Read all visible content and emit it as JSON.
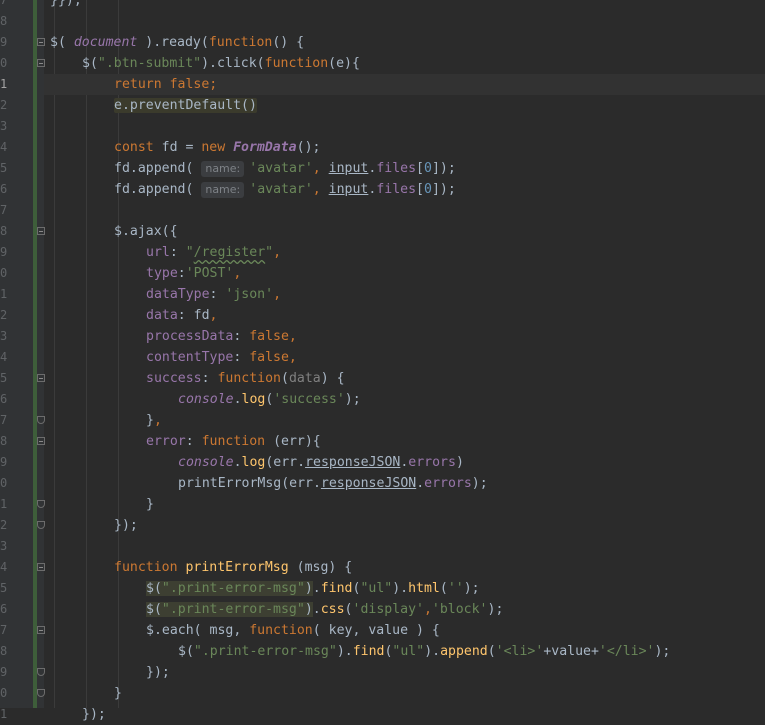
{
  "editor": {
    "current_line_index": 4,
    "lines": [
      {
        "num": "7",
        "fold": "",
        "indent": 0,
        "tokens": [
          [
            "p",
            "}});"
          ]
        ]
      },
      {
        "num": "8",
        "fold": "",
        "indent": 0,
        "tokens": []
      },
      {
        "num": "9",
        "fold": "open",
        "indent": 0,
        "tokens": [
          [
            "p",
            "$( "
          ],
          [
            "glob",
            "document"
          ],
          [
            "p",
            " ).ready("
          ],
          [
            "kw",
            "function"
          ],
          [
            "p",
            "() {"
          ]
        ]
      },
      {
        "num": "0",
        "fold": "open",
        "indent": 1,
        "tokens": [
          [
            "p",
            "$("
          ],
          [
            "str",
            "\".btn-submit\""
          ],
          [
            "p",
            ").click("
          ],
          [
            "kw",
            "function"
          ],
          [
            "p",
            "(e){"
          ]
        ]
      },
      {
        "num": "1",
        "fold": "",
        "indent": 2,
        "tokens": [
          [
            "kw",
            "return "
          ],
          [
            "kw",
            "false"
          ],
          [
            "kw",
            ";"
          ]
        ]
      },
      {
        "num": "2",
        "fold": "",
        "indent": 2,
        "tokens": [
          [
            "hl",
            "e.preventDefault()"
          ]
        ]
      },
      {
        "num": "3",
        "fold": "",
        "indent": 0,
        "tokens": []
      },
      {
        "num": "4",
        "fold": "",
        "indent": 2,
        "tokens": [
          [
            "kw",
            "const "
          ],
          [
            "p",
            "fd = "
          ],
          [
            "kw",
            "new "
          ],
          [
            "cls",
            "FormData"
          ],
          [
            "p",
            "();"
          ]
        ]
      },
      {
        "num": "5",
        "fold": "",
        "indent": 2,
        "tokens": [
          [
            "p",
            "fd.append( "
          ],
          [
            "hint",
            "name:"
          ],
          [
            "str",
            "'avatar'"
          ],
          [
            "kw",
            ", "
          ],
          [
            "ul",
            "input"
          ],
          [
            "p",
            "."
          ],
          [
            "prop",
            "files"
          ],
          [
            "p",
            "["
          ],
          [
            "num",
            "0"
          ],
          [
            "p",
            "]);"
          ]
        ]
      },
      {
        "num": "6",
        "fold": "",
        "indent": 2,
        "tokens": [
          [
            "p",
            "fd.append( "
          ],
          [
            "hint",
            "name:"
          ],
          [
            "str",
            "'avatar'"
          ],
          [
            "kw",
            ", "
          ],
          [
            "ul",
            "input"
          ],
          [
            "p",
            "."
          ],
          [
            "prop",
            "files"
          ],
          [
            "p",
            "["
          ],
          [
            "num",
            "0"
          ],
          [
            "p",
            "]);"
          ]
        ]
      },
      {
        "num": "7",
        "fold": "",
        "indent": 0,
        "tokens": []
      },
      {
        "num": "8",
        "fold": "open",
        "indent": 2,
        "tokens": [
          [
            "p",
            "$.ajax({"
          ]
        ]
      },
      {
        "num": "9",
        "fold": "",
        "indent": 3,
        "tokens": [
          [
            "prop",
            "url"
          ],
          [
            "p",
            ": "
          ],
          [
            "str",
            "\""
          ],
          [
            "wavy",
            "/register"
          ],
          [
            "str",
            "\""
          ],
          [
            "kw",
            ","
          ]
        ]
      },
      {
        "num": "0",
        "fold": "",
        "indent": 3,
        "tokens": [
          [
            "prop",
            "type"
          ],
          [
            "p",
            ":"
          ],
          [
            "str",
            "'POST'"
          ],
          [
            "kw",
            ","
          ]
        ]
      },
      {
        "num": "1",
        "fold": "",
        "indent": 3,
        "tokens": [
          [
            "prop",
            "dataType"
          ],
          [
            "p",
            ": "
          ],
          [
            "str",
            "'json'"
          ],
          [
            "kw",
            ","
          ]
        ]
      },
      {
        "num": "2",
        "fold": "",
        "indent": 3,
        "tokens": [
          [
            "prop",
            "data"
          ],
          [
            "p",
            ": fd"
          ],
          [
            "kw",
            ","
          ]
        ]
      },
      {
        "num": "3",
        "fold": "",
        "indent": 3,
        "tokens": [
          [
            "prop",
            "processData"
          ],
          [
            "p",
            ": "
          ],
          [
            "kw",
            "false,"
          ]
        ]
      },
      {
        "num": "4",
        "fold": "",
        "indent": 3,
        "tokens": [
          [
            "prop",
            "contentType"
          ],
          [
            "p",
            ": "
          ],
          [
            "kw",
            "false,"
          ]
        ]
      },
      {
        "num": "5",
        "fold": "open",
        "indent": 3,
        "tokens": [
          [
            "prop",
            "success"
          ],
          [
            "p",
            ": "
          ],
          [
            "kw",
            "function"
          ],
          [
            "p",
            "("
          ],
          [
            "dim",
            "data"
          ],
          [
            "p",
            ") {"
          ]
        ]
      },
      {
        "num": "6",
        "fold": "",
        "indent": 4,
        "tokens": [
          [
            "glob",
            "console"
          ],
          [
            "p",
            "."
          ],
          [
            "fn",
            "log"
          ],
          [
            "p",
            "("
          ],
          [
            "str",
            "'success'"
          ],
          [
            "p",
            ");"
          ]
        ]
      },
      {
        "num": "7",
        "fold": "end",
        "indent": 3,
        "tokens": [
          [
            "p",
            "}"
          ],
          [
            "kw",
            ","
          ]
        ]
      },
      {
        "num": "8",
        "fold": "open",
        "indent": 3,
        "tokens": [
          [
            "prop",
            "error"
          ],
          [
            "p",
            ": "
          ],
          [
            "kw",
            "function "
          ],
          [
            "p",
            "(err){"
          ]
        ]
      },
      {
        "num": "9",
        "fold": "",
        "indent": 4,
        "tokens": [
          [
            "glob",
            "console"
          ],
          [
            "p",
            "."
          ],
          [
            "fn",
            "log"
          ],
          [
            "p",
            "(err."
          ],
          [
            "ul",
            "responseJSON"
          ],
          [
            "p",
            "."
          ],
          [
            "prop",
            "errors"
          ],
          [
            "p",
            ")"
          ]
        ]
      },
      {
        "num": "0",
        "fold": "",
        "indent": 4,
        "tokens": [
          [
            "p",
            "printErrorMsg(err."
          ],
          [
            "ul",
            "responseJSON"
          ],
          [
            "p",
            "."
          ],
          [
            "prop",
            "errors"
          ],
          [
            "p",
            ");"
          ]
        ]
      },
      {
        "num": "1",
        "fold": "end",
        "indent": 3,
        "tokens": [
          [
            "p",
            "}"
          ]
        ]
      },
      {
        "num": "2",
        "fold": "end",
        "indent": 2,
        "tokens": [
          [
            "p",
            "});"
          ]
        ]
      },
      {
        "num": "3",
        "fold": "",
        "indent": 0,
        "tokens": []
      },
      {
        "num": "4",
        "fold": "open",
        "indent": 2,
        "tokens": [
          [
            "kw",
            "function "
          ],
          [
            "fn",
            "printErrorMsg "
          ],
          [
            "p",
            "(msg) {"
          ]
        ]
      },
      {
        "num": "5",
        "fold": "",
        "indent": 3,
        "tokens": [
          [
            "hl2",
            "$("
          ],
          [
            "hl2s",
            "\".print-error-msg\""
          ],
          [
            "hl2",
            ")"
          ],
          [
            "p",
            "."
          ],
          [
            "fn",
            "find"
          ],
          [
            "p",
            "("
          ],
          [
            "str",
            "\"ul\""
          ],
          [
            "p",
            ")."
          ],
          [
            "fn",
            "html"
          ],
          [
            "p",
            "("
          ],
          [
            "str",
            "''"
          ],
          [
            "p",
            ");"
          ]
        ]
      },
      {
        "num": "6",
        "fold": "",
        "indent": 3,
        "tokens": [
          [
            "hl2",
            "$("
          ],
          [
            "hl2s",
            "\".print-error-msg\""
          ],
          [
            "hl2",
            ")"
          ],
          [
            "p",
            "."
          ],
          [
            "fn",
            "css"
          ],
          [
            "p",
            "("
          ],
          [
            "str",
            "'display'"
          ],
          [
            "kw",
            ","
          ],
          [
            "str",
            "'block'"
          ],
          [
            "p",
            ");"
          ]
        ]
      },
      {
        "num": "7",
        "fold": "open",
        "indent": 3,
        "tokens": [
          [
            "p",
            "$.each( msg, "
          ],
          [
            "kw",
            "function"
          ],
          [
            "p",
            "( key, value ) {"
          ]
        ]
      },
      {
        "num": "8",
        "fold": "",
        "indent": 4,
        "tokens": [
          [
            "p",
            "$("
          ],
          [
            "str",
            "\".print-error-msg\""
          ],
          [
            "p",
            ")."
          ],
          [
            "fn",
            "find"
          ],
          [
            "p",
            "("
          ],
          [
            "str",
            "\"ul\""
          ],
          [
            "p",
            ")."
          ],
          [
            "fn",
            "append"
          ],
          [
            "p",
            "("
          ],
          [
            "str",
            "'<li>'"
          ],
          [
            "p",
            "+value+"
          ],
          [
            "str",
            "'</li>'"
          ],
          [
            "p",
            ");"
          ]
        ]
      },
      {
        "num": "9",
        "fold": "end",
        "indent": 3,
        "tokens": [
          [
            "p",
            "});"
          ]
        ]
      },
      {
        "num": "0",
        "fold": "end",
        "indent": 2,
        "tokens": [
          [
            "p",
            "}"
          ]
        ]
      },
      {
        "num": "1",
        "fold": "",
        "indent": 1,
        "tokens": [
          [
            "p",
            "});"
          ]
        ]
      }
    ]
  }
}
